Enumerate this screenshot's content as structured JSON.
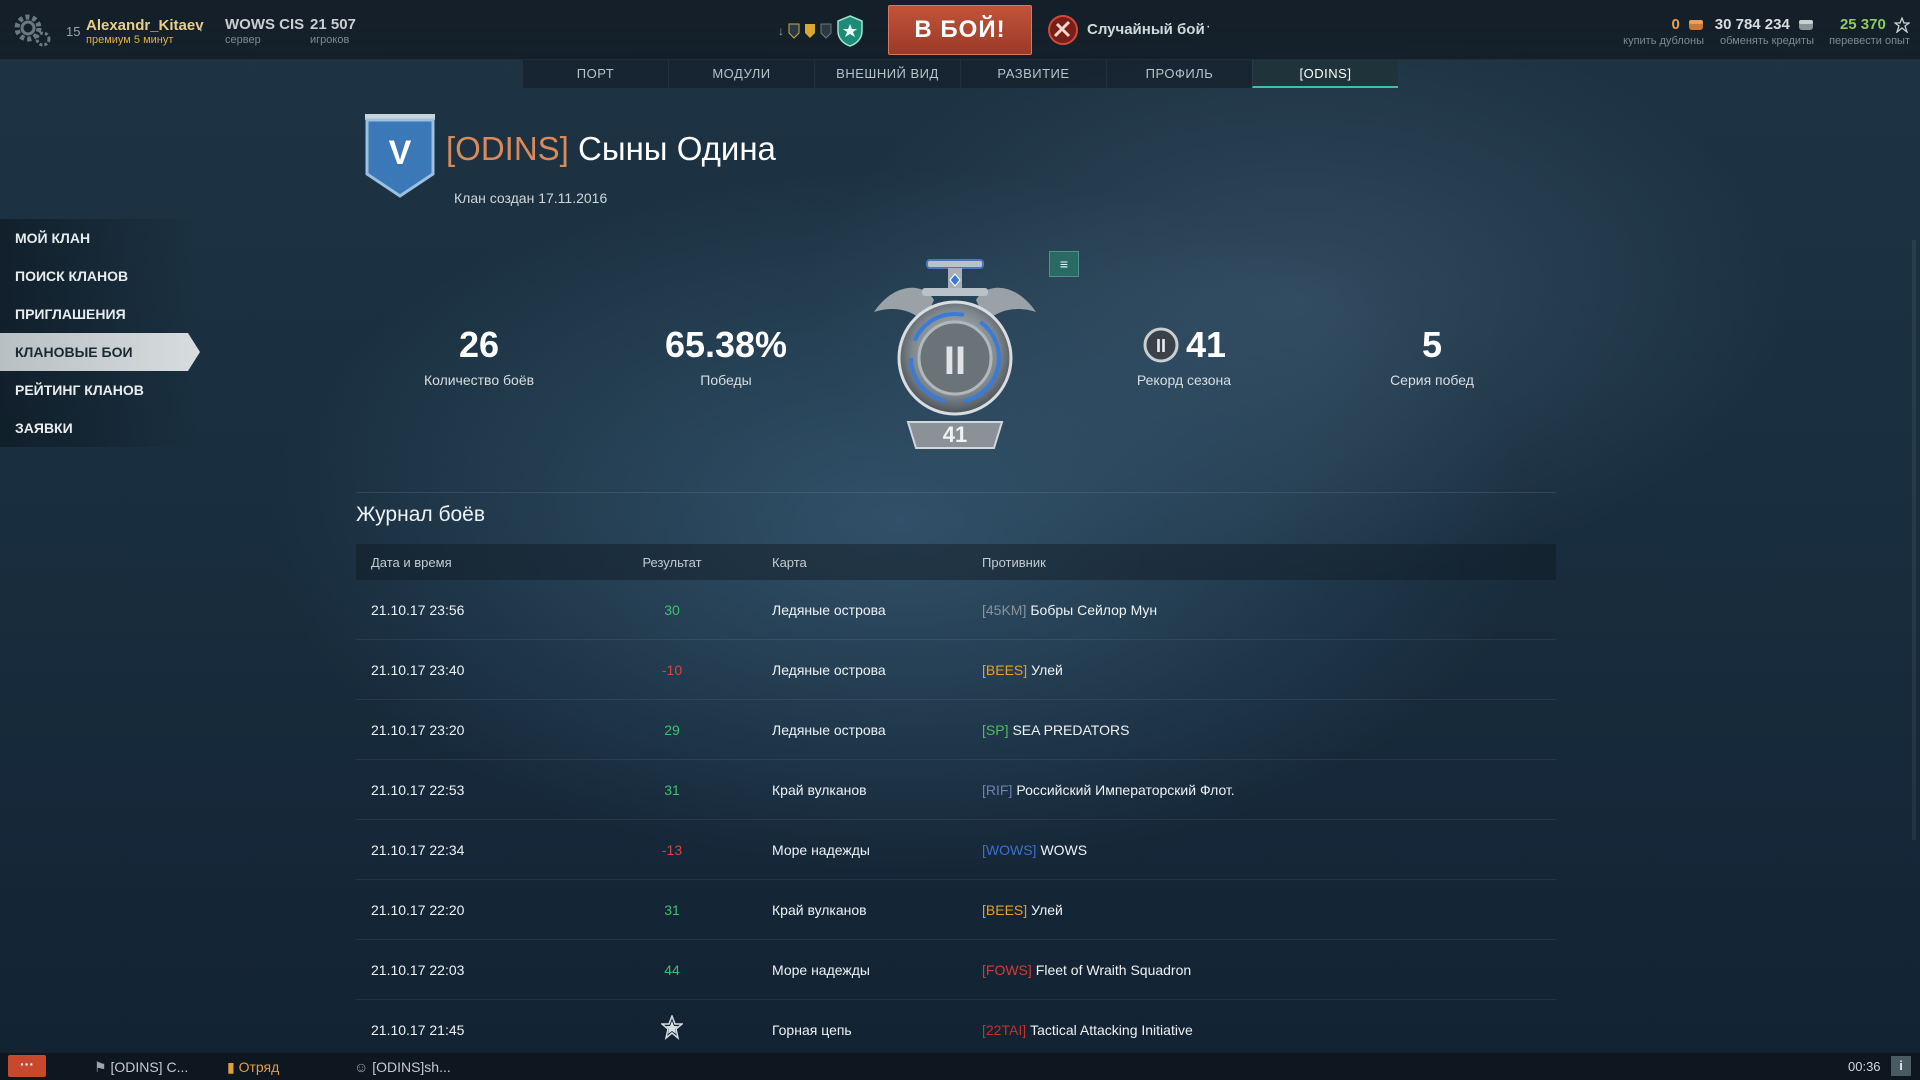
{
  "user": {
    "level": "15",
    "name": "Alexandr_Kitaev",
    "premium": "премиум 5 минут",
    "server": "WOWS CIS",
    "server_sub": "сервер",
    "players": "21 507",
    "players_sub": "игроков"
  },
  "battle_button": "В БОЙ!",
  "battle_mode": "Случайный бой",
  "battle_mode_more": "···",
  "currencies": [
    {
      "value": "0",
      "label": "купить дублоны",
      "color": "#e8a050"
    },
    {
      "value": "30 784 234",
      "label": "обменять кредиты",
      "color": "#d8dee1"
    },
    {
      "value": "25 370",
      "label": "перевести опыт",
      "color": "#8ccc60"
    }
  ],
  "tabs": [
    {
      "label": "ПОРТ",
      "active": false
    },
    {
      "label": "МОДУЛИ",
      "active": false
    },
    {
      "label": "ВНЕШНИЙ ВИД",
      "active": false
    },
    {
      "label": "РАЗВИТИЕ",
      "active": false
    },
    {
      "label": "ПРОФИЛЬ",
      "active": false
    },
    {
      "label": "[ODINS]",
      "active": true
    }
  ],
  "sidebar": [
    {
      "label": "МОЙ КЛАН",
      "active": false
    },
    {
      "label": "ПОИСК КЛАНОВ",
      "active": false
    },
    {
      "label": "ПРИГЛАШЕНИЯ",
      "active": false
    },
    {
      "label": "КЛАНОВЫЕ БОИ",
      "active": true
    },
    {
      "label": "РЕЙТИНГ КЛАНОВ",
      "active": false
    },
    {
      "label": "ЗАЯВКИ",
      "active": false
    }
  ],
  "clan": {
    "emblem_letter": "V",
    "tag": "[ODINS]",
    "name": "Сыны Одина",
    "created": "Клан создан 17.11.2016"
  },
  "stats": {
    "battles": "26",
    "battles_label": "Количество боёв",
    "winrate": "65.38%",
    "winrate_label": "Победы",
    "league_badge_roman": "II",
    "league_rating": "41",
    "season_record": "41",
    "season_record_badge": "II",
    "season_record_label": "Рекорд сезона",
    "win_streak": "5",
    "win_streak_label": "Серия побед"
  },
  "log": {
    "title": "Журнал боёв",
    "headers": {
      "date": "Дата и время",
      "result": "Результат",
      "map": "Карта",
      "opponent": "Противник"
    },
    "rows": [
      {
        "date": "21.10.17 23:56",
        "result": "30",
        "sign": "pos",
        "map": "Ледяные острова",
        "tag": "[45KM]",
        "tag_color": "#8a949a",
        "opponent": "Бобры Сейлор Мун"
      },
      {
        "date": "21.10.17 23:40",
        "result": "-10",
        "sign": "neg",
        "map": "Ледяные острова",
        "tag": "[BEES]",
        "tag_color": "#e8a020",
        "opponent": "Улей"
      },
      {
        "date": "21.10.17 23:20",
        "result": "29",
        "sign": "pos",
        "map": "Ледяные острова",
        "tag": "[SP]",
        "tag_color": "#4cbf5c",
        "opponent": "SEA PREDATORS"
      },
      {
        "date": "21.10.17 22:53",
        "result": "31",
        "sign": "pos",
        "map": "Край вулканов",
        "tag": "[RIF]",
        "tag_color": "#7080b0",
        "opponent": "Российский Императорский Флот."
      },
      {
        "date": "21.10.17 22:34",
        "result": "-13",
        "sign": "neg",
        "map": "Море надежды",
        "tag": "[WOWS]",
        "tag_color": "#3c70d0",
        "opponent": "WOWS"
      },
      {
        "date": "21.10.17 22:20",
        "result": "31",
        "sign": "pos",
        "map": "Край вулканов",
        "tag": "[BEES]",
        "tag_color": "#e8a020",
        "opponent": "Улей"
      },
      {
        "date": "21.10.17 22:03",
        "result": "44",
        "sign": "pos",
        "map": "Море надежды",
        "tag": "[FOWS]",
        "tag_color": "#d83a30",
        "opponent": "Fleet of Wraith Squadron"
      },
      {
        "date": "21.10.17 21:45",
        "result": "",
        "sign": "promo",
        "map": "Горная цепь",
        "tag": "[22TAI]",
        "tag_color": "#c83028",
        "opponent": "Tactical Attacking Initiative"
      }
    ]
  },
  "bottom": {
    "chat": "···",
    "clan_chat": "[ODINS] С...",
    "division": "Отряд",
    "contacts": "[ODINS]sh...",
    "time": "00:36",
    "info": "i"
  }
}
